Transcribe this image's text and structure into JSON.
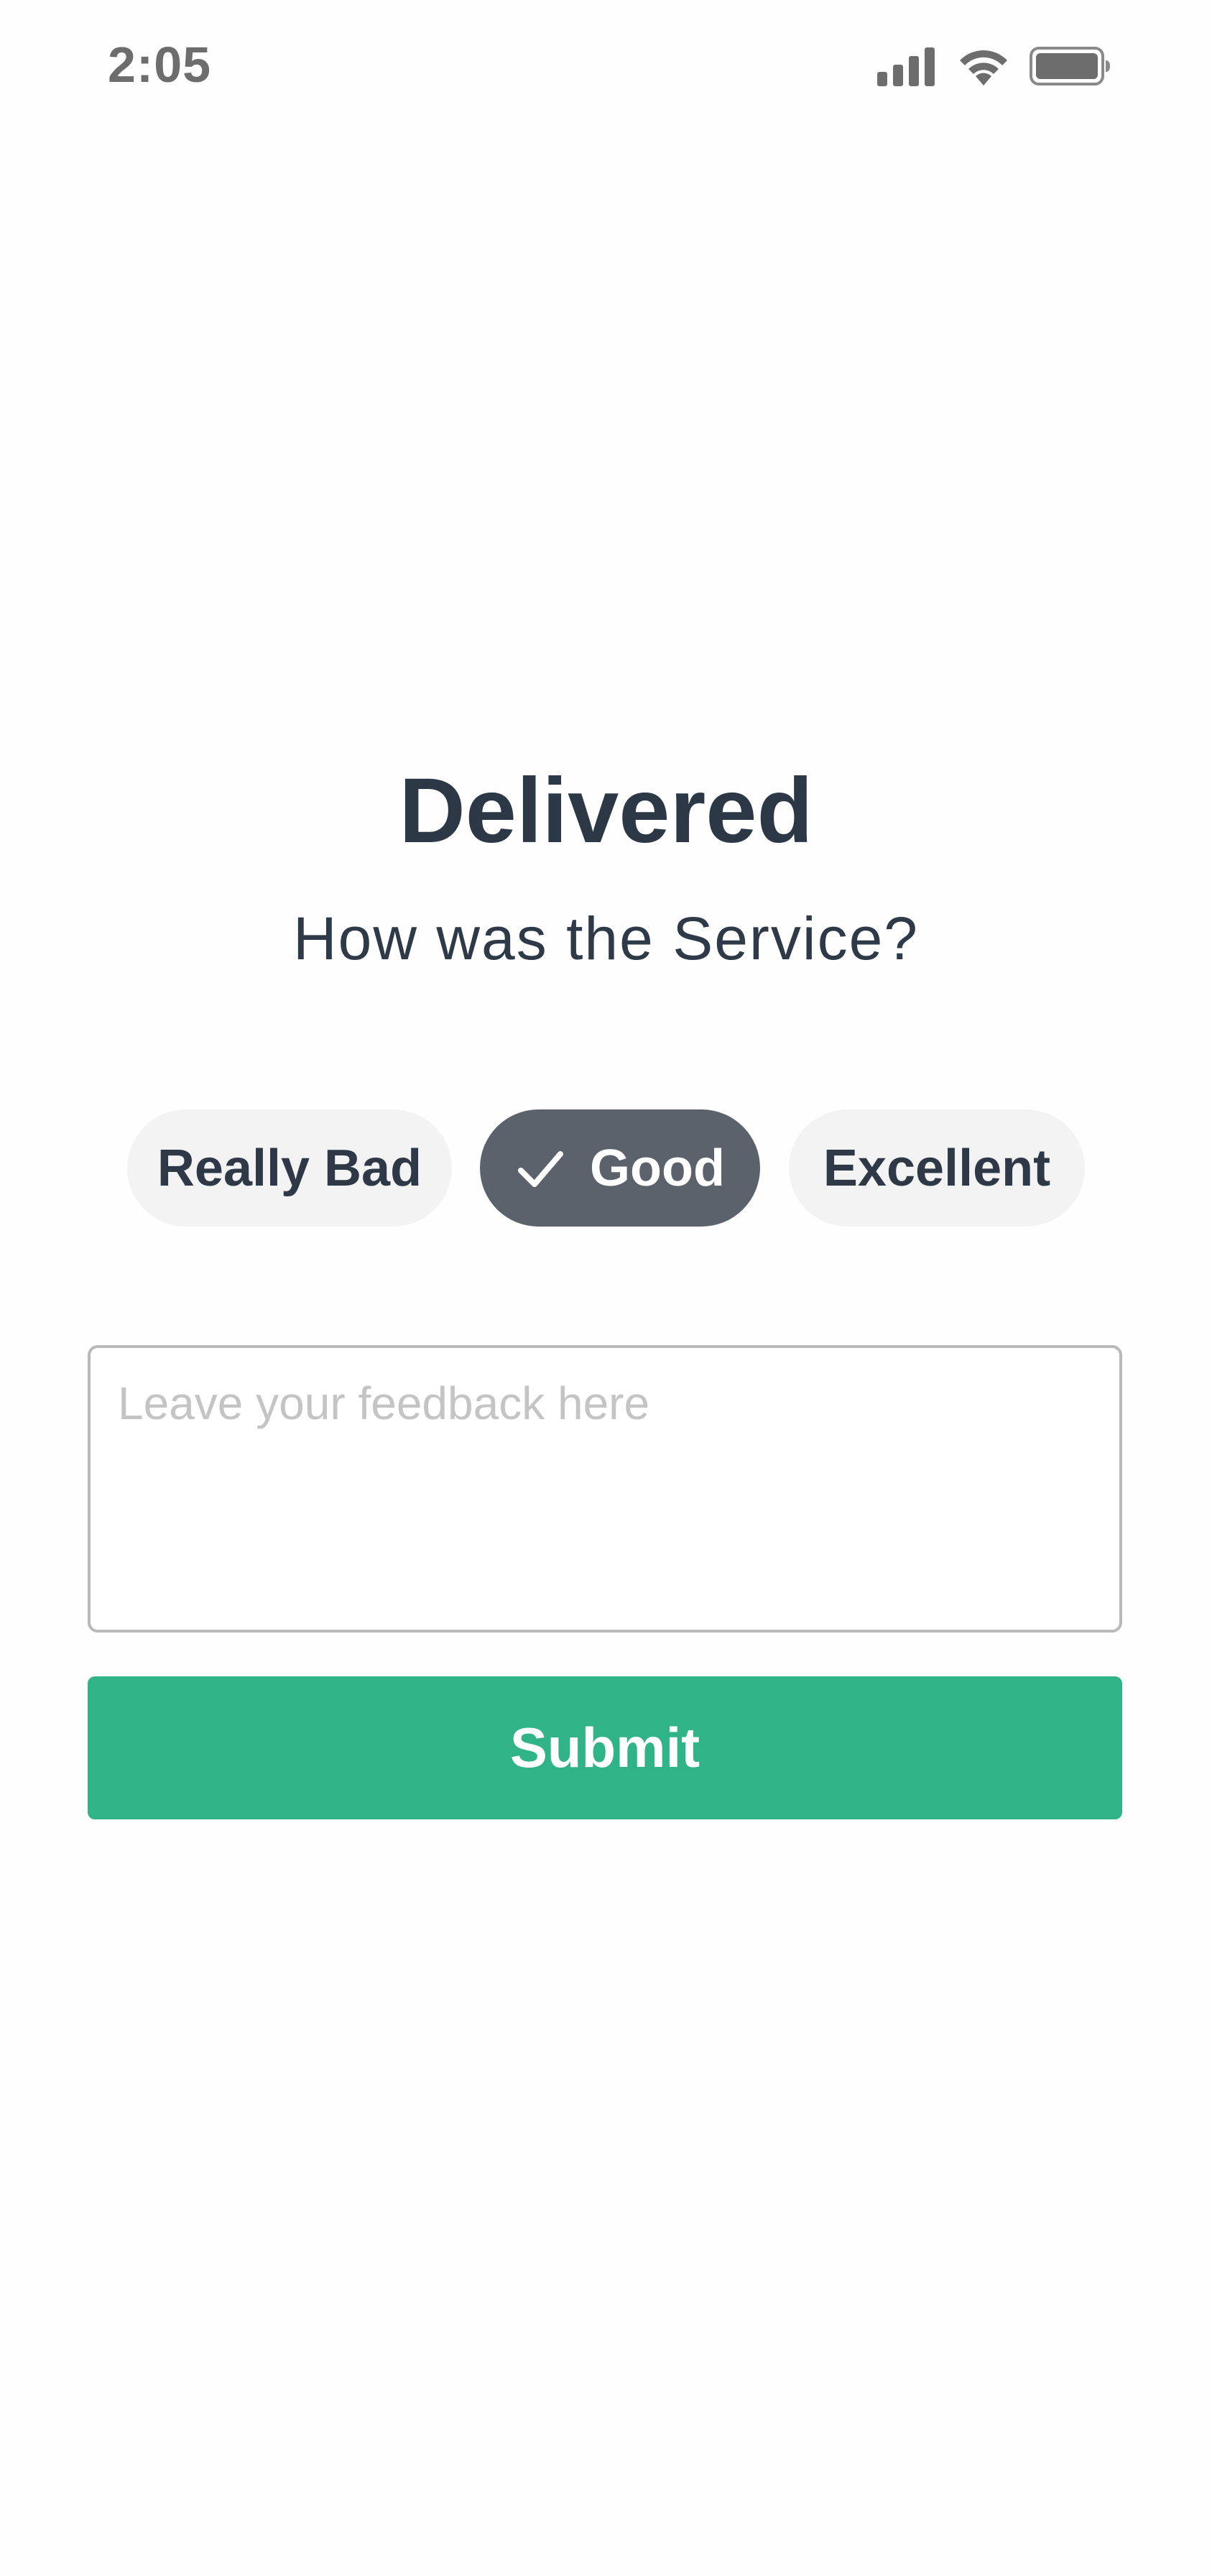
{
  "status_bar": {
    "time": "2:05",
    "icons": [
      "cellular-signal-icon",
      "wifi-icon",
      "battery-icon"
    ]
  },
  "header": {
    "title": "Delivered",
    "subtitle": "How was the Service?"
  },
  "rating": {
    "options": [
      {
        "label": "Really Bad",
        "selected": false
      },
      {
        "label": "Good",
        "selected": true
      },
      {
        "label": "Excellent",
        "selected": false
      }
    ],
    "selected_icon": "checkmark-icon"
  },
  "feedback": {
    "value": "",
    "placeholder": "Leave your feedback here"
  },
  "actions": {
    "submit_label": "Submit"
  },
  "colors": {
    "text_primary": "#2d3847",
    "chip_background": "#f3f3f3",
    "chip_selected_background": "#5b626c",
    "submit_background": "#30b386",
    "status_text": "#6d6d6d"
  }
}
